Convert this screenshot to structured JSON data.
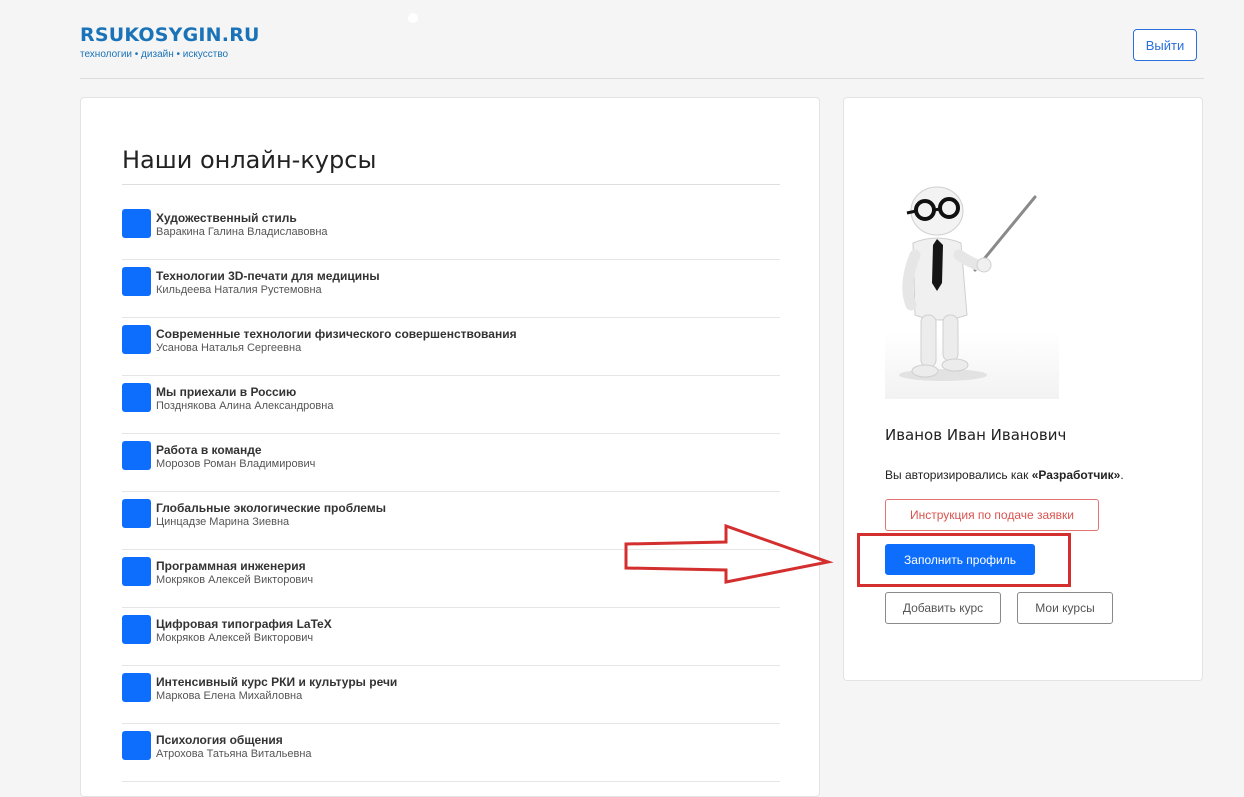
{
  "header": {
    "logo_title": "RSUKOSYGIN.RU",
    "logo_subtitle": "технологии • дизайн • искусство",
    "logout_label": "Выйти"
  },
  "courses": {
    "title": "Наши онлайн-курсы",
    "items": [
      {
        "name": "Художественный стиль",
        "author": "Варакина Галина Владиславовна"
      },
      {
        "name": "Технологии 3D-печати для медицины",
        "author": "Кильдеева Наталия Рустемовна"
      },
      {
        "name": "Современные технологии физического совершенствования",
        "author": "Усанова Наталья Сергеевна"
      },
      {
        "name": "Мы приехали в Россию",
        "author": "Позднякова Алина Александровна"
      },
      {
        "name": "Работа в команде",
        "author": "Морозов Роман Владимирович"
      },
      {
        "name": "Глобальные экологические проблемы",
        "author": "Цинцадзе Марина Зиевна"
      },
      {
        "name": "Программная инженерия",
        "author": "Мокряков Алексей Викторович"
      },
      {
        "name": "Цифровая типография LaTeX",
        "author": "Мокряков Алексей Викторович"
      },
      {
        "name": "Интенсивный курс РКИ и культуры речи",
        "author": "Маркова Елена Михайловна"
      },
      {
        "name": "Психология общения",
        "author": "Атрохова Татьяна Витальевна"
      }
    ]
  },
  "profile": {
    "name": "Иванов Иван Иванович",
    "auth_prefix": "Вы авторизировались как ",
    "auth_role": "«Разработчик»",
    "auth_suffix": ".",
    "instruction_button": "Инструкция по подаче заявки",
    "fill_profile_button": "Заполнить профиль",
    "add_course_button": "Добавить курс",
    "my_courses_button": "Мои курсы"
  },
  "colors": {
    "brand": "#1a73b8",
    "primary": "#0d6efd",
    "danger": "#d9534f",
    "annotation": "#d32f2f"
  },
  "icons": {
    "course_icon": "blue-square-icon",
    "avatar": "teacher-figure-with-pointer",
    "annotation_arrow": "right-arrow-outline"
  }
}
